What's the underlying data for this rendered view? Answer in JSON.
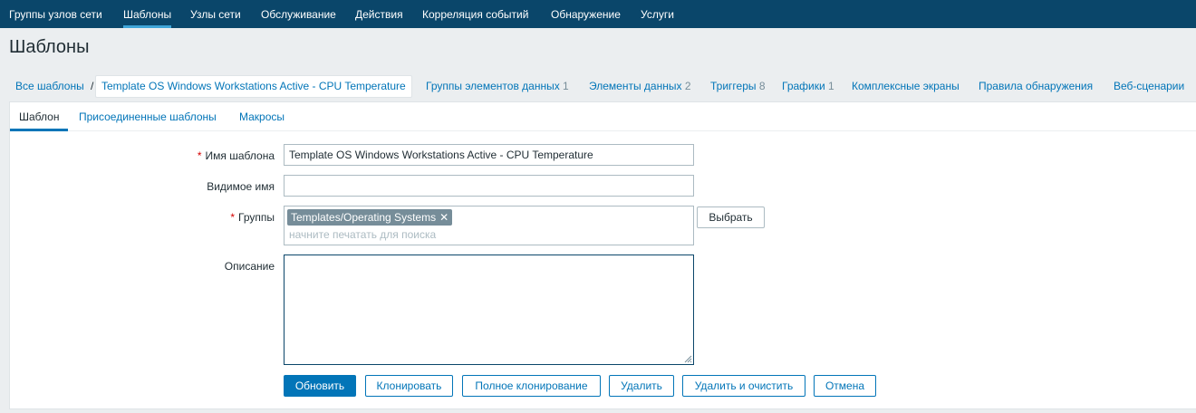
{
  "topnav": {
    "items": [
      "Группы узлов сети",
      "Шаблоны",
      "Узлы сети",
      "Обслуживание",
      "Действия",
      "Корреляция событий",
      "Обнаружение",
      "Услуги"
    ],
    "active_index": 1
  },
  "page": {
    "title": "Шаблоны"
  },
  "breadcrumbs": {
    "all_templates": "Все шаблоны",
    "separator": "/",
    "current": "Template OS Windows Workstations Active - CPU Temperature",
    "links": [
      {
        "label": "Группы элементов данных",
        "count": "1"
      },
      {
        "label": "Элементы данных",
        "count": "2"
      },
      {
        "label": "Триггеры",
        "count": "8"
      },
      {
        "label": "Графики",
        "count": "1"
      },
      {
        "label": "Комплексные экраны",
        "count": ""
      },
      {
        "label": "Правила обнаружения",
        "count": ""
      },
      {
        "label": "Веб-сценарии",
        "count": ""
      }
    ]
  },
  "tabs": [
    "Шаблон",
    "Присоединенные шаблоны",
    "Макросы"
  ],
  "form": {
    "required_mark": "*",
    "template_name": {
      "label": "Имя шаблона",
      "value": "Template OS Windows Workstations Active - CPU Temperature"
    },
    "visible_name": {
      "label": "Видимое имя",
      "value": ""
    },
    "groups": {
      "label": "Группы",
      "chip": "Templates/Operating Systems",
      "placeholder": "начните печатать для поиска",
      "select_button": "Выбрать"
    },
    "description": {
      "label": "Описание",
      "value": ""
    }
  },
  "buttons": {
    "update": "Обновить",
    "clone": "Клонировать",
    "full_clone": "Полное клонирование",
    "delete": "Удалить",
    "delete_clear": "Удалить и очистить",
    "cancel": "Отмена"
  },
  "colors": {
    "header_bg": "#0a466a",
    "accent": "#0275b8",
    "required": "#d40000"
  }
}
